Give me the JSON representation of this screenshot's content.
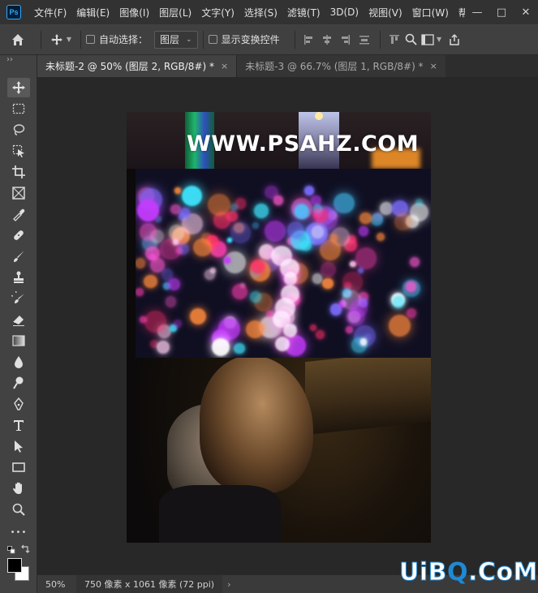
{
  "app": {
    "logo": "Ps"
  },
  "menu": [
    "文件(F)",
    "编辑(E)",
    "图像(I)",
    "图层(L)",
    "文字(Y)",
    "选择(S)",
    "滤镜(T)",
    "3D(D)",
    "视图(V)",
    "窗口(W)",
    "帮"
  ],
  "window_controls": {
    "minimize": "—",
    "restore": "□",
    "close": "✕"
  },
  "options": {
    "auto_select_label": "自动选择：",
    "auto_select_value": "图层",
    "show_transform_label": "显示变换控件"
  },
  "tabs": [
    {
      "label": "未标题-2 @ 50% (图层 2, RGB/8#) *",
      "close": "×",
      "active": true
    },
    {
      "label": "未标题-3 @ 66.7% (图层 1, RGB/8#) *",
      "close": "×",
      "active": false
    }
  ],
  "toolbar": {
    "collapse": "››",
    "more": "•••"
  },
  "canvas": {
    "watermark_text": "WWW.PSAHZ.COM"
  },
  "status": {
    "zoom": "50%",
    "doc_info": "750 像素 x 1061 像素 (72 ppi)",
    "arrow": "›"
  },
  "brand": {
    "text_a": "UiB",
    "text_b": "Q",
    "text_c": ".CoM"
  },
  "colors": {
    "accent": "#31a8ff",
    "foreground": "#000000",
    "background": "#ffffff"
  }
}
